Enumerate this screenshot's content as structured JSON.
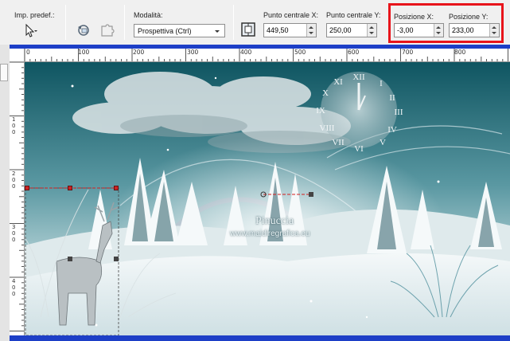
{
  "toolbar": {
    "preset": {
      "label": "Imp. predef.:",
      "icon": "arrow-cursor-icon"
    },
    "mode": {
      "label": "Modalità:",
      "value": "Prospettiva (Ctrl)"
    },
    "center_x": {
      "label": "Punto centrale X:",
      "value": "449,50"
    },
    "center_y": {
      "label": "Punto centrale Y:",
      "value": "250,00"
    },
    "pos_x": {
      "label": "Posizione X:",
      "value": "-3,00"
    },
    "pos_y": {
      "label": "Posizione Y:",
      "value": "233,00"
    },
    "highlight_color": "#e8141b"
  },
  "ruler": {
    "horizontal": [
      "0",
      "100",
      "200",
      "300",
      "400",
      "500",
      "600",
      "700",
      "800"
    ],
    "vertical": [
      "1",
      "0",
      "0",
      "2",
      "0",
      "0",
      "3",
      "0",
      "0",
      "4",
      "0",
      "0"
    ]
  },
  "canvas": {
    "watermark_name": "Pinuccia",
    "watermark_url": "www.maidiregrafica.eu",
    "frame_color": "#1d3fc7"
  }
}
